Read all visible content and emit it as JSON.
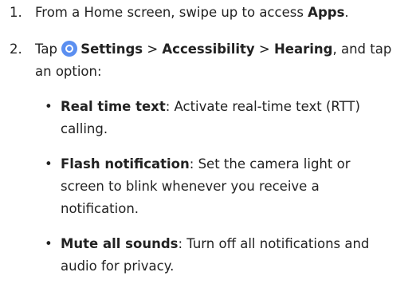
{
  "steps": [
    {
      "number": "1.",
      "prefix": "From a Home screen, swipe up to access ",
      "bold": "Apps",
      "suffix": "."
    },
    {
      "number": "2.",
      "prefix": "Tap ",
      "icon": "settings-gear-icon",
      "settings": "Settings",
      "sep1": " > ",
      "accessibility": "Accessibility",
      "sep2": " > ",
      "hearing": "Hearing",
      "tail": ", and tap",
      "line2": "an option:"
    }
  ],
  "bullets": [
    {
      "label": "Real time text",
      "line1": ": Activate real-time text (RTT)",
      "line2": "calling."
    },
    {
      "label": "Flash notification",
      "line1": ": Set the camera light or",
      "line2": "screen to blink whenever you receive a",
      "line3": "notification."
    },
    {
      "label": "Mute all sounds",
      "line1": ": Turn off all notifications and",
      "line2": "audio for privacy."
    }
  ]
}
